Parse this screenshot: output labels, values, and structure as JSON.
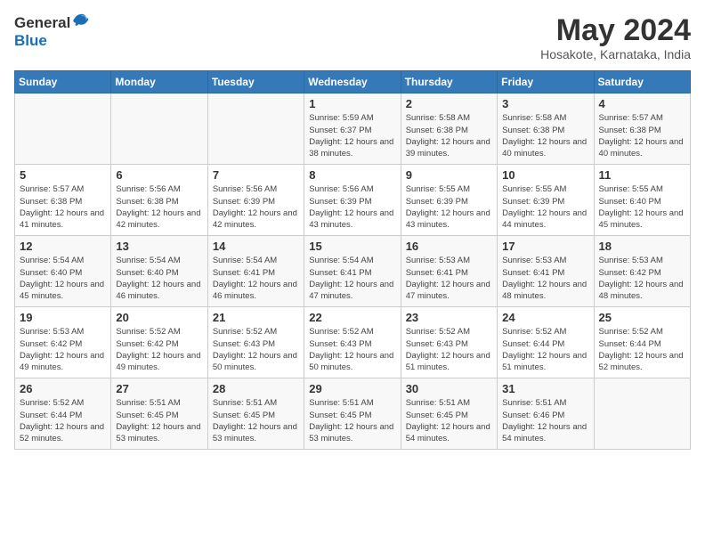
{
  "logo": {
    "general": "General",
    "blue": "Blue"
  },
  "title": {
    "month_year": "May 2024",
    "location": "Hosakote, Karnataka, India"
  },
  "weekdays": [
    "Sunday",
    "Monday",
    "Tuesday",
    "Wednesday",
    "Thursday",
    "Friday",
    "Saturday"
  ],
  "weeks": [
    [
      {
        "day": "",
        "info": ""
      },
      {
        "day": "",
        "info": ""
      },
      {
        "day": "",
        "info": ""
      },
      {
        "day": "1",
        "sunrise": "5:59 AM",
        "sunset": "6:37 PM",
        "daylight": "12 hours and 38 minutes."
      },
      {
        "day": "2",
        "sunrise": "5:58 AM",
        "sunset": "6:38 PM",
        "daylight": "12 hours and 39 minutes."
      },
      {
        "day": "3",
        "sunrise": "5:58 AM",
        "sunset": "6:38 PM",
        "daylight": "12 hours and 40 minutes."
      },
      {
        "day": "4",
        "sunrise": "5:57 AM",
        "sunset": "6:38 PM",
        "daylight": "12 hours and 40 minutes."
      }
    ],
    [
      {
        "day": "5",
        "sunrise": "5:57 AM",
        "sunset": "6:38 PM",
        "daylight": "12 hours and 41 minutes."
      },
      {
        "day": "6",
        "sunrise": "5:56 AM",
        "sunset": "6:38 PM",
        "daylight": "12 hours and 42 minutes."
      },
      {
        "day": "7",
        "sunrise": "5:56 AM",
        "sunset": "6:39 PM",
        "daylight": "12 hours and 42 minutes."
      },
      {
        "day": "8",
        "sunrise": "5:56 AM",
        "sunset": "6:39 PM",
        "daylight": "12 hours and 43 minutes."
      },
      {
        "day": "9",
        "sunrise": "5:55 AM",
        "sunset": "6:39 PM",
        "daylight": "12 hours and 43 minutes."
      },
      {
        "day": "10",
        "sunrise": "5:55 AM",
        "sunset": "6:39 PM",
        "daylight": "12 hours and 44 minutes."
      },
      {
        "day": "11",
        "sunrise": "5:55 AM",
        "sunset": "6:40 PM",
        "daylight": "12 hours and 45 minutes."
      }
    ],
    [
      {
        "day": "12",
        "sunrise": "5:54 AM",
        "sunset": "6:40 PM",
        "daylight": "12 hours and 45 minutes."
      },
      {
        "day": "13",
        "sunrise": "5:54 AM",
        "sunset": "6:40 PM",
        "daylight": "12 hours and 46 minutes."
      },
      {
        "day": "14",
        "sunrise": "5:54 AM",
        "sunset": "6:41 PM",
        "daylight": "12 hours and 46 minutes."
      },
      {
        "day": "15",
        "sunrise": "5:54 AM",
        "sunset": "6:41 PM",
        "daylight": "12 hours and 47 minutes."
      },
      {
        "day": "16",
        "sunrise": "5:53 AM",
        "sunset": "6:41 PM",
        "daylight": "12 hours and 47 minutes."
      },
      {
        "day": "17",
        "sunrise": "5:53 AM",
        "sunset": "6:41 PM",
        "daylight": "12 hours and 48 minutes."
      },
      {
        "day": "18",
        "sunrise": "5:53 AM",
        "sunset": "6:42 PM",
        "daylight": "12 hours and 48 minutes."
      }
    ],
    [
      {
        "day": "19",
        "sunrise": "5:53 AM",
        "sunset": "6:42 PM",
        "daylight": "12 hours and 49 minutes."
      },
      {
        "day": "20",
        "sunrise": "5:52 AM",
        "sunset": "6:42 PM",
        "daylight": "12 hours and 49 minutes."
      },
      {
        "day": "21",
        "sunrise": "5:52 AM",
        "sunset": "6:43 PM",
        "daylight": "12 hours and 50 minutes."
      },
      {
        "day": "22",
        "sunrise": "5:52 AM",
        "sunset": "6:43 PM",
        "daylight": "12 hours and 50 minutes."
      },
      {
        "day": "23",
        "sunrise": "5:52 AM",
        "sunset": "6:43 PM",
        "daylight": "12 hours and 51 minutes."
      },
      {
        "day": "24",
        "sunrise": "5:52 AM",
        "sunset": "6:44 PM",
        "daylight": "12 hours and 51 minutes."
      },
      {
        "day": "25",
        "sunrise": "5:52 AM",
        "sunset": "6:44 PM",
        "daylight": "12 hours and 52 minutes."
      }
    ],
    [
      {
        "day": "26",
        "sunrise": "5:52 AM",
        "sunset": "6:44 PM",
        "daylight": "12 hours and 52 minutes."
      },
      {
        "day": "27",
        "sunrise": "5:51 AM",
        "sunset": "6:45 PM",
        "daylight": "12 hours and 53 minutes."
      },
      {
        "day": "28",
        "sunrise": "5:51 AM",
        "sunset": "6:45 PM",
        "daylight": "12 hours and 53 minutes."
      },
      {
        "day": "29",
        "sunrise": "5:51 AM",
        "sunset": "6:45 PM",
        "daylight": "12 hours and 53 minutes."
      },
      {
        "day": "30",
        "sunrise": "5:51 AM",
        "sunset": "6:45 PM",
        "daylight": "12 hours and 54 minutes."
      },
      {
        "day": "31",
        "sunrise": "5:51 AM",
        "sunset": "6:46 PM",
        "daylight": "12 hours and 54 minutes."
      },
      {
        "day": "",
        "info": ""
      }
    ]
  ]
}
